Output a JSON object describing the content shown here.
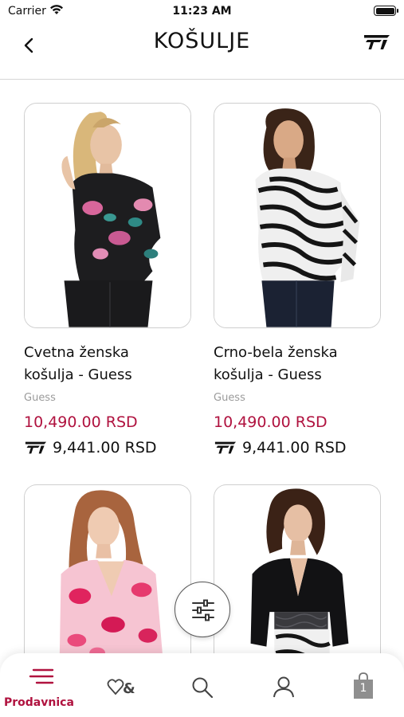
{
  "status_bar": {
    "carrier": "Carrier",
    "time": "11:23 AM"
  },
  "nav": {
    "title": "KOŠULJE"
  },
  "products": [
    {
      "name_line1": "Cvetna ženska",
      "name_line2": "košulja - Guess",
      "brand": "Guess",
      "price": "10,490.00 RSD",
      "member_price": "9,441.00 RSD"
    },
    {
      "name_line1": "Crno-bela ženska",
      "name_line2": "košulja - Guess",
      "brand": "Guess",
      "price": "10,490.00 RSD",
      "member_price": "9,441.00 RSD"
    },
    {
      "image_icon": "pink-floral-blouse-image"
    },
    {
      "image_icon": "black-lace-top-image"
    }
  ],
  "tab_bar": {
    "items": [
      {
        "label": "Prodavnica",
        "icon": "shop-menu-icon",
        "active": true
      },
      {
        "icon": "wishlist-heart-icon"
      },
      {
        "icon": "search-icon"
      },
      {
        "icon": "profile-icon"
      },
      {
        "icon": "cart-bag-icon",
        "badge": "1"
      }
    ]
  },
  "colors": {
    "accent": "#b0123f",
    "text": "#111111",
    "muted": "#9b9b9b",
    "divider": "#d6d6d6"
  }
}
